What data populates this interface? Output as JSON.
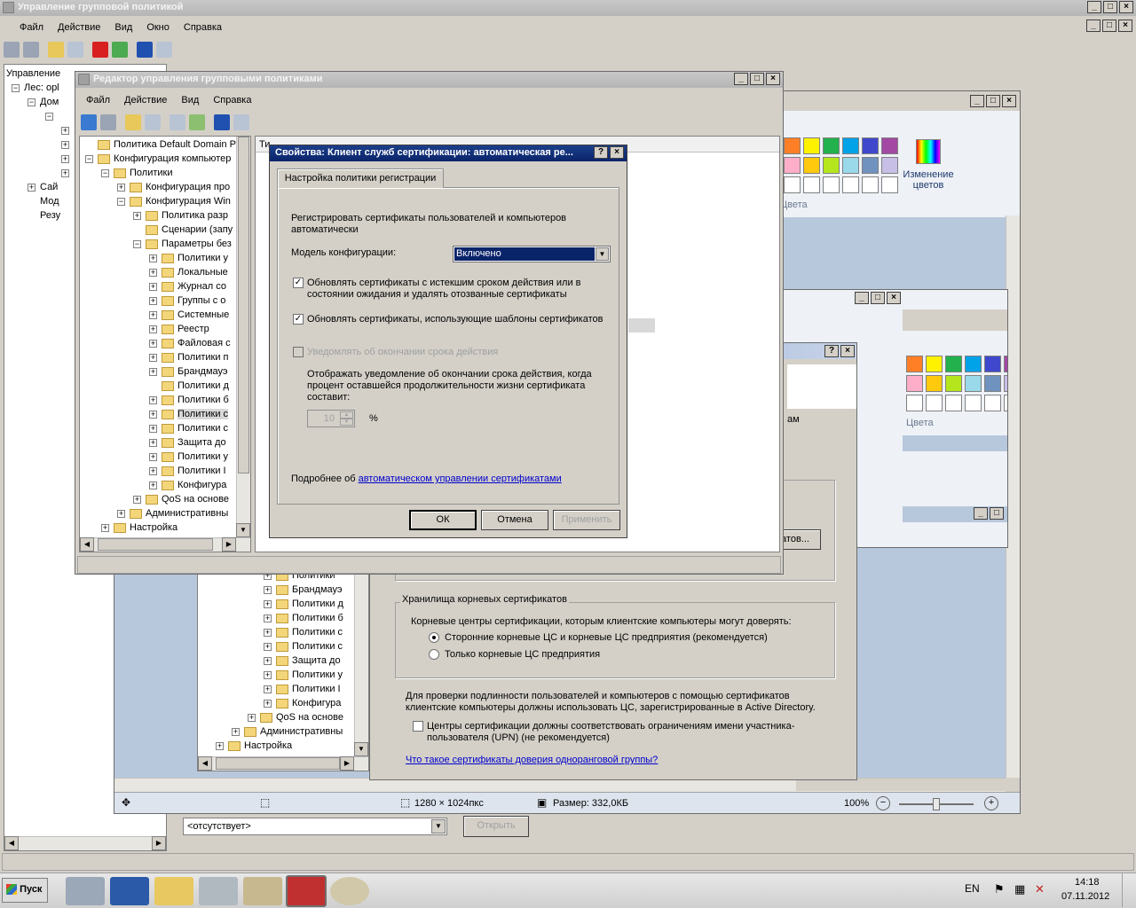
{
  "main_window": {
    "title": "Управление групповой политикой",
    "menu": [
      "Файл",
      "Действие",
      "Вид",
      "Окно",
      "Справка"
    ],
    "tree": [
      "Управление",
      "Лес: opl",
      "Дом",
      "Сай",
      "Мод",
      "Резу"
    ],
    "dropdown_value": "<отсутствует>",
    "open_button": "Открыть"
  },
  "paint_window": {
    "change_colors": "Изменение цветов",
    "colors_label": "Цвета",
    "status_dimensions": "1280 × 1024пкс",
    "status_size": "Размер: 332,0КБ",
    "zoom": "100%",
    "palette": [
      "#ff7f27",
      "#fff200",
      "#22b14c",
      "#00a2e8",
      "#3f48cc",
      "#a349a4",
      "#ffaec9",
      "#ffc90e",
      "#b5e61d",
      "#99d9ea",
      "#7092be",
      "#c8bfe7"
    ]
  },
  "bg_props": {
    "root_store_title": "Хранилища корневых сертификатов",
    "root_store_desc": "Корневые центры сертификации, которым клиентские компьютеры могут доверять:",
    "radio1": "Сторонние корневые ЦС и корневые ЦС предприятия (рекомендуется)",
    "radio2": "Только корневые ЦС предприятия",
    "auth_desc": "Для проверки подлинности пользователей и компьютеров с помощью сертификатов клиентские компьютеры должны использовать ЦС, зарегистрированные в Active Directory.",
    "upn_check": "Центры сертификации должны соответствовать ограничениям имени участника-пользователя (UPN) (не рекомендуется)",
    "peer_link": "Что такое сертификаты доверия одноранговой группы?",
    "partial_btn": "атов...",
    "partial_text": "ам"
  },
  "bg_tree": [
    "Политики",
    "Брандмауэ",
    "Политики д",
    "Политики б",
    "Политики с",
    "Политики с",
    "Защита до",
    "Политики у",
    "Политики I",
    "Конфигура",
    "QoS на основе",
    "Административны",
    "Настройка"
  ],
  "editor": {
    "title": "Редактор управления групповыми политиками",
    "menu": [
      "Файл",
      "Действие",
      "Вид",
      "Справка"
    ],
    "right_header": "Ти",
    "tree": [
      {
        "t": "Политика Default Domain Polic",
        "lvl": 0,
        "pm": ""
      },
      {
        "t": "Конфигурация компьютер",
        "lvl": 0,
        "pm": "−"
      },
      {
        "t": "Политики",
        "lvl": 1,
        "pm": "−"
      },
      {
        "t": "Конфигурация про",
        "lvl": 2,
        "pm": "+"
      },
      {
        "t": "Конфигурация Win",
        "lvl": 2,
        "pm": "−"
      },
      {
        "t": "Политика разр",
        "lvl": 3,
        "pm": "+"
      },
      {
        "t": "Сценарии (запу",
        "lvl": 3,
        "pm": ""
      },
      {
        "t": "Параметры без",
        "lvl": 3,
        "pm": "−"
      },
      {
        "t": "Политики у",
        "lvl": 4,
        "pm": "+"
      },
      {
        "t": "Локальные",
        "lvl": 4,
        "pm": "+"
      },
      {
        "t": "Журнал со",
        "lvl": 4,
        "pm": "+"
      },
      {
        "t": "Группы с о",
        "lvl": 4,
        "pm": "+"
      },
      {
        "t": "Системные",
        "lvl": 4,
        "pm": "+"
      },
      {
        "t": "Реестр",
        "lvl": 4,
        "pm": "+"
      },
      {
        "t": "Файловая с",
        "lvl": 4,
        "pm": "+"
      },
      {
        "t": "Политики п",
        "lvl": 4,
        "pm": "+"
      },
      {
        "t": "Брандмауэ",
        "lvl": 4,
        "pm": "+"
      },
      {
        "t": "Политики д",
        "lvl": 4,
        "pm": ""
      },
      {
        "t": "Политики б",
        "lvl": 4,
        "pm": "+"
      },
      {
        "t": "Политики с",
        "lvl": 4,
        "pm": "+",
        "sel": true
      },
      {
        "t": "Политики с",
        "lvl": 4,
        "pm": "+"
      },
      {
        "t": "Защита до",
        "lvl": 4,
        "pm": "+"
      },
      {
        "t": "Политики у",
        "lvl": 4,
        "pm": "+"
      },
      {
        "t": "Политики I",
        "lvl": 4,
        "pm": "+"
      },
      {
        "t": "Конфигура",
        "lvl": 4,
        "pm": "+"
      },
      {
        "t": "QoS на основе",
        "lvl": 3,
        "pm": "+"
      },
      {
        "t": "Административны",
        "lvl": 2,
        "pm": "+"
      },
      {
        "t": "Настройка",
        "lvl": 1,
        "pm": "+"
      }
    ]
  },
  "dialog": {
    "title": "Свойства: Клиент служб сертификации: автоматическая ре...",
    "tab": "Настройка политики регистрации",
    "desc": "Регистрировать сертификаты пользователей и компьютеров автоматически",
    "model_label": "Модель конфигурации:",
    "model_value": "Включено",
    "check1": "Обновлять сертификаты с истекшим сроком действия или в состоянии  ожидания и удалять отозванные сертификаты",
    "check2": "Обновлять сертификаты, использующие шаблоны сертификатов",
    "check3": "Уведомлять об окончании срока действия",
    "notify_desc": "Отображать уведомление об окончании срока действия, когда процент оставшейся продолжительности жизни сертификата составит:",
    "percent_value": "10",
    "percent_sign": "%",
    "more_prefix": "Подробнее об ",
    "more_link": "автоматическом управлении сертификатами",
    "ok": "ОК",
    "cancel": "Отмена",
    "apply": "Применить"
  },
  "taskbar": {
    "start": "Пуск",
    "lang": "EN",
    "time": "14:18",
    "date": "07.11.2012"
  }
}
